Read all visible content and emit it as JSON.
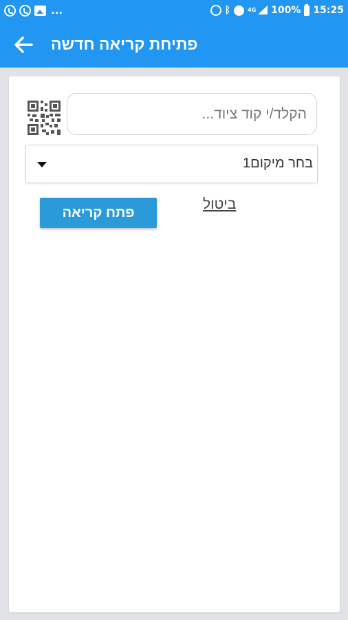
{
  "status_bar": {
    "more_indicator": "...",
    "battery_percent": "100%",
    "time": "15:25",
    "network_type": "4G",
    "icons_left": [
      "whatsapp-icon",
      "whatsapp-icon",
      "gallery-icon"
    ],
    "icons_right": [
      "sync-icon",
      "bluetooth-icon",
      "alarm-icon",
      "network-icon",
      "signal-icon",
      "battery-icon"
    ]
  },
  "app_bar": {
    "title": "פתיחת קריאה חדשה",
    "back_icon": "arrow-left-icon",
    "color": "#2196f3"
  },
  "form": {
    "device_code_placeholder": "הקלד/י קוד ציוד...",
    "device_code_value": "",
    "qr_icon": "qr-code-icon",
    "location_selected": "בחר מיקום1",
    "cancel_label": "ביטול",
    "submit_label": "פתח קריאה",
    "submit_color": "#2a9ad8"
  }
}
